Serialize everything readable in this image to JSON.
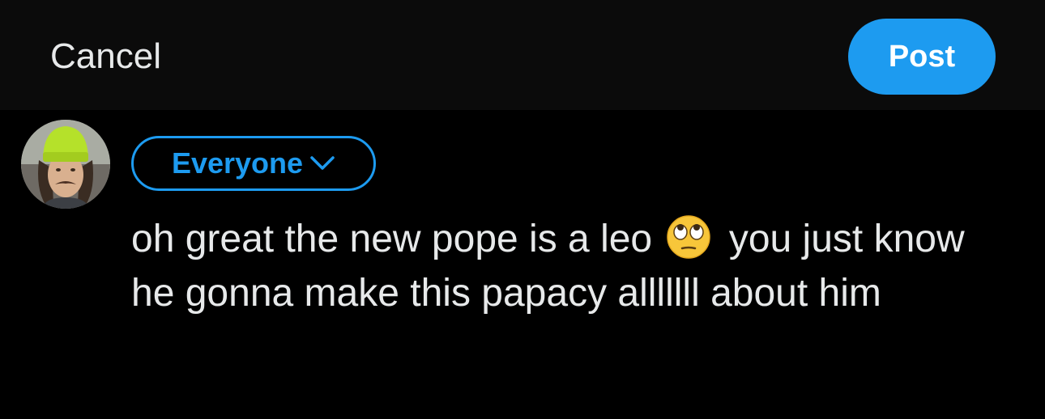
{
  "header": {
    "cancel_label": "Cancel",
    "post_label": "Post"
  },
  "composer": {
    "audience_label": "Everyone",
    "text_before_emoji": "oh great the new pope is a leo",
    "emoji_name": "face-with-rolling-eyes-icon",
    "text_after_emoji": "you just know he gonna make this papacy alllllll about him"
  },
  "colors": {
    "accent": "#1d9bf0",
    "background": "#000000",
    "header_background": "#0b0b0b",
    "text": "#e7e9ea"
  }
}
